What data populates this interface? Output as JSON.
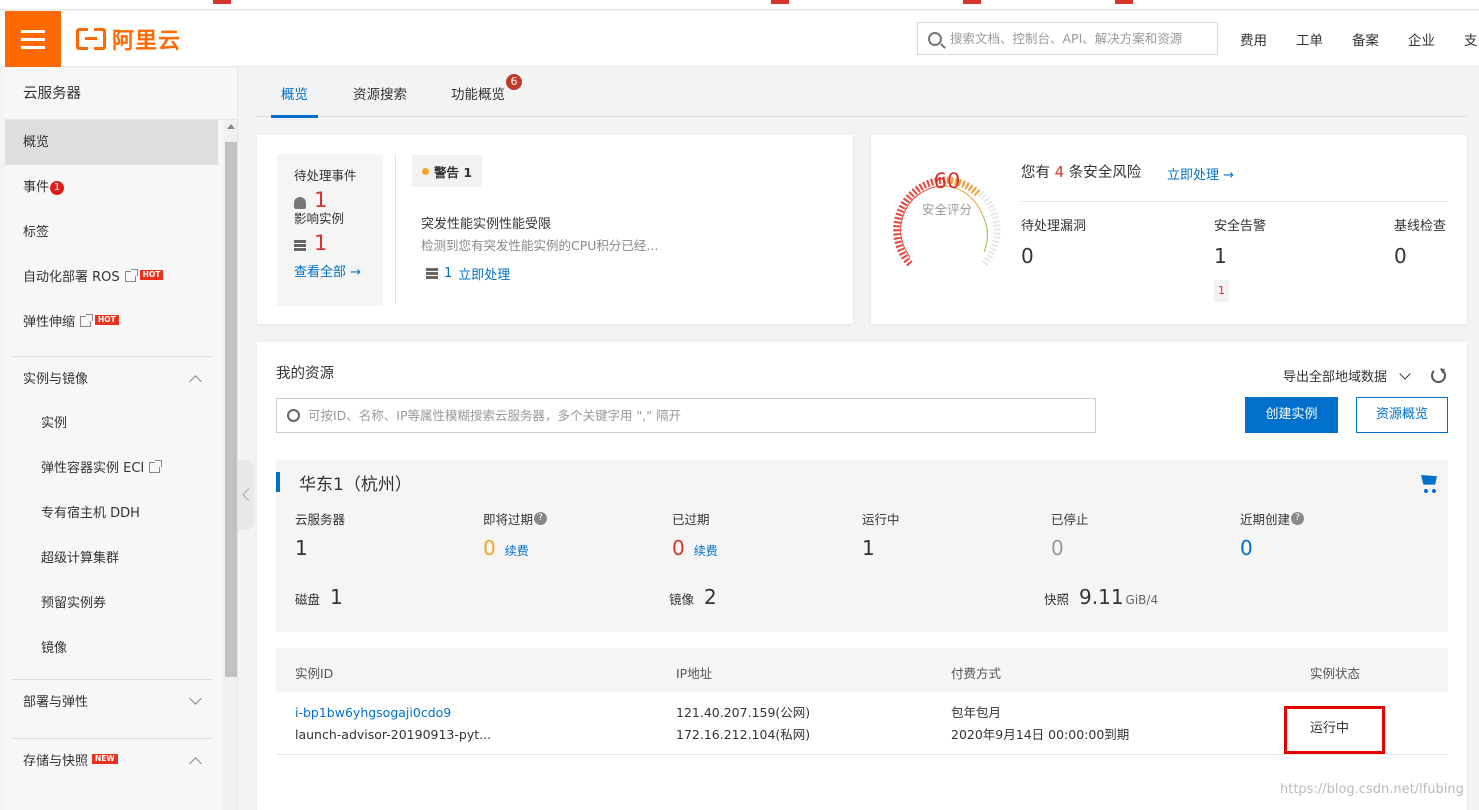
{
  "topbar": {
    "brand": "阿里云",
    "search_placeholder": "搜索文档、控制台、API、解决方案和资源",
    "nav": [
      "费用",
      "工单",
      "备案",
      "企业",
      "支"
    ]
  },
  "sidebar": {
    "title": "云服务器",
    "items": [
      {
        "label": "概览"
      },
      {
        "label": "事件",
        "badge": "1"
      },
      {
        "label": "标签"
      },
      {
        "label": "自动化部署 ROS",
        "hot": "HOT"
      },
      {
        "label": "弹性伸缩",
        "hot": "HOT"
      }
    ],
    "group1": "实例与镜像",
    "sub_items": [
      "实例",
      "弹性容器实例 ECI",
      "专有宿主机 DDH",
      "超级计算集群",
      "预留实例券",
      "镜像"
    ],
    "group2": "部署与弹性",
    "group3": "存储与快照",
    "new_tag": "NEW"
  },
  "tabs": [
    {
      "label": "概览",
      "active": true
    },
    {
      "label": "资源搜索"
    },
    {
      "label": "功能概览",
      "badge": "6"
    }
  ],
  "pending": {
    "title": "待处理事件",
    "events_count": "1",
    "affected_label": "影响实例",
    "affected_count": "1",
    "view_all": "查看全部 →",
    "warning_chip": "警告 1",
    "event_title": "突发性能实例性能受限",
    "event_desc": "检测到您有突发性能实例的CPU积分已经...",
    "event_count": "1",
    "event_action": "立即处理"
  },
  "security": {
    "score": "60",
    "score_label": "安全评分",
    "risk_prefix": "您有",
    "risk_count": "4",
    "risk_suffix": "条安全风险",
    "risk_action": "立即处理 →",
    "cols": [
      {
        "label": "待处理漏洞",
        "value": "0"
      },
      {
        "label": "安全告警",
        "value": "1",
        "sub": "1"
      },
      {
        "label": "基线检查",
        "value": "0"
      }
    ]
  },
  "resources": {
    "title": "我的资源",
    "export": "导出全部地域数据",
    "search_placeholder": "可按ID、名称、IP等属性模糊搜索云服务器，多个关键字用 \",\" 隔开",
    "create_btn": "创建实例",
    "overview_btn": "资源概览",
    "region": "华东1（杭州）",
    "stats": [
      {
        "label": "云服务器",
        "value": "1"
      },
      {
        "label": "即将过期",
        "value": "0",
        "renew": "续费",
        "help": true
      },
      {
        "label": "已过期",
        "value": "0",
        "renew": "续费"
      },
      {
        "label": "运行中",
        "value": "1"
      },
      {
        "label": "已停止",
        "value": "0"
      },
      {
        "label": "近期创建",
        "value": "0",
        "help": true
      }
    ],
    "disk_label": "磁盘",
    "disk_value": "1",
    "image_label": "镜像",
    "image_value": "2",
    "snap_label": "快照",
    "snap_value": "9.11",
    "snap_unit": "GiB/4",
    "table": {
      "headers": [
        "实例ID",
        "IP地址",
        "付费方式",
        "实例状态"
      ],
      "rows": [
        {
          "id": "i-bp1bw6yhgsogaji0cdo9",
          "name": "launch-advisor-20190913-pyt...",
          "ip_public": "121.40.207.159(公网)",
          "ip_private": "172.16.212.104(私网)",
          "billing": "包年包月",
          "expire": "2020年9月14日 00:00:00到期",
          "status": "运行中"
        }
      ]
    }
  },
  "watermark": "https://blog.csdn.net/lfubing",
  "colors": {
    "brand": "#ff6a00",
    "link": "#0070cc",
    "danger": "#d9342b"
  }
}
